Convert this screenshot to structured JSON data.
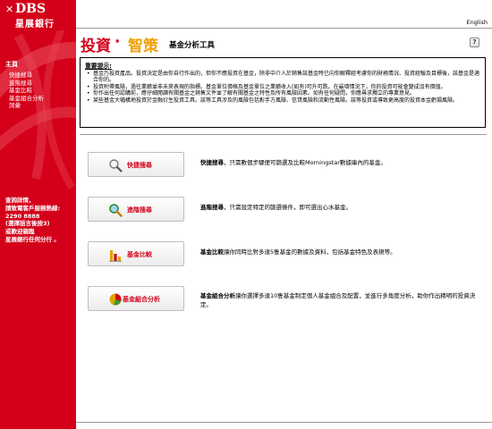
{
  "logo": {
    "mark": "✕",
    "name": "DBS",
    "chinese": "星展銀行"
  },
  "topbar": {
    "language": "English"
  },
  "header": {
    "brand_part1": "投資",
    "brand_dot": "·",
    "brand_part2": "智策",
    "title": "基金分析工具",
    "help": "?"
  },
  "sidebar": {
    "heading": "主頁",
    "items": [
      {
        "label": "快捷搜尋"
      },
      {
        "label": "進階搜尋"
      },
      {
        "label": "基金比較"
      },
      {
        "label": "基金組合分析"
      },
      {
        "label": "詞彙"
      }
    ],
    "contact": [
      "查詢詳情，",
      "請致電客戶服務熱線:",
      "2290 8888",
      "(選擇語言後按3)",
      "或歡迎親臨",
      "星展銀行任何分行 。"
    ]
  },
  "notice": {
    "title": "重要提示:",
    "items": [
      "基金乃投資產品。投資決定是由你自行作出的，但你不應投資在基金，除非中介人於銷售該基金時已向你解釋經考慮你的財務情況、投資經驗及目標後，該基金是適合你的。",
      "投資附帶風險，過往業績並非未來表現的指標。基金單位價格及基金單位之業績收入(如有)可升可跌。在最壞情況下，你的投資可能會變成沒有價值。",
      "你作出任何認購前，應仔細閱讀有關基金之銷售文件並了解有關基金之特性及所有風險因素。如有任何疑問，你應尋求獨立的專業意見。",
      "某些基金大幅橫地投資於金融衍生投資工具。該等工具涉及的風險包括對手方風險、信貸風險和流動性風險。該等投資或導致更高度的投資本金虧損風險。"
    ]
  },
  "tools": [
    {
      "button": "快捷搜尋",
      "icon": "magnifier-icon",
      "desc_bold": "快捷搜尋",
      "desc": "，只需數個步驟便可篩選及比較Morningstar數據庫內的基金。"
    },
    {
      "button": "進階搜尋",
      "icon": "magnifier-color-icon",
      "desc_bold": "進階搜尋",
      "desc": "，只需設定特定的篩選條件，即可選出心水基金。"
    },
    {
      "button": "基金比較",
      "icon": "bar-chart-icon",
      "desc_bold": "基金比較",
      "desc": "讓你同時比對多達5隻基金的數據及資料，包括基金特色及表現等。"
    },
    {
      "button": "基金組合分析",
      "icon": "pie-chart-icon",
      "desc_bold": "基金組合分析",
      "desc": "讓你選擇多達10隻基金制定個人基金組合及配置，並進行多角度分析，助你作出精明的投資決定。"
    }
  ],
  "colors": {
    "brand_red": "#d4001a",
    "brand_orange": "#f0a000"
  }
}
